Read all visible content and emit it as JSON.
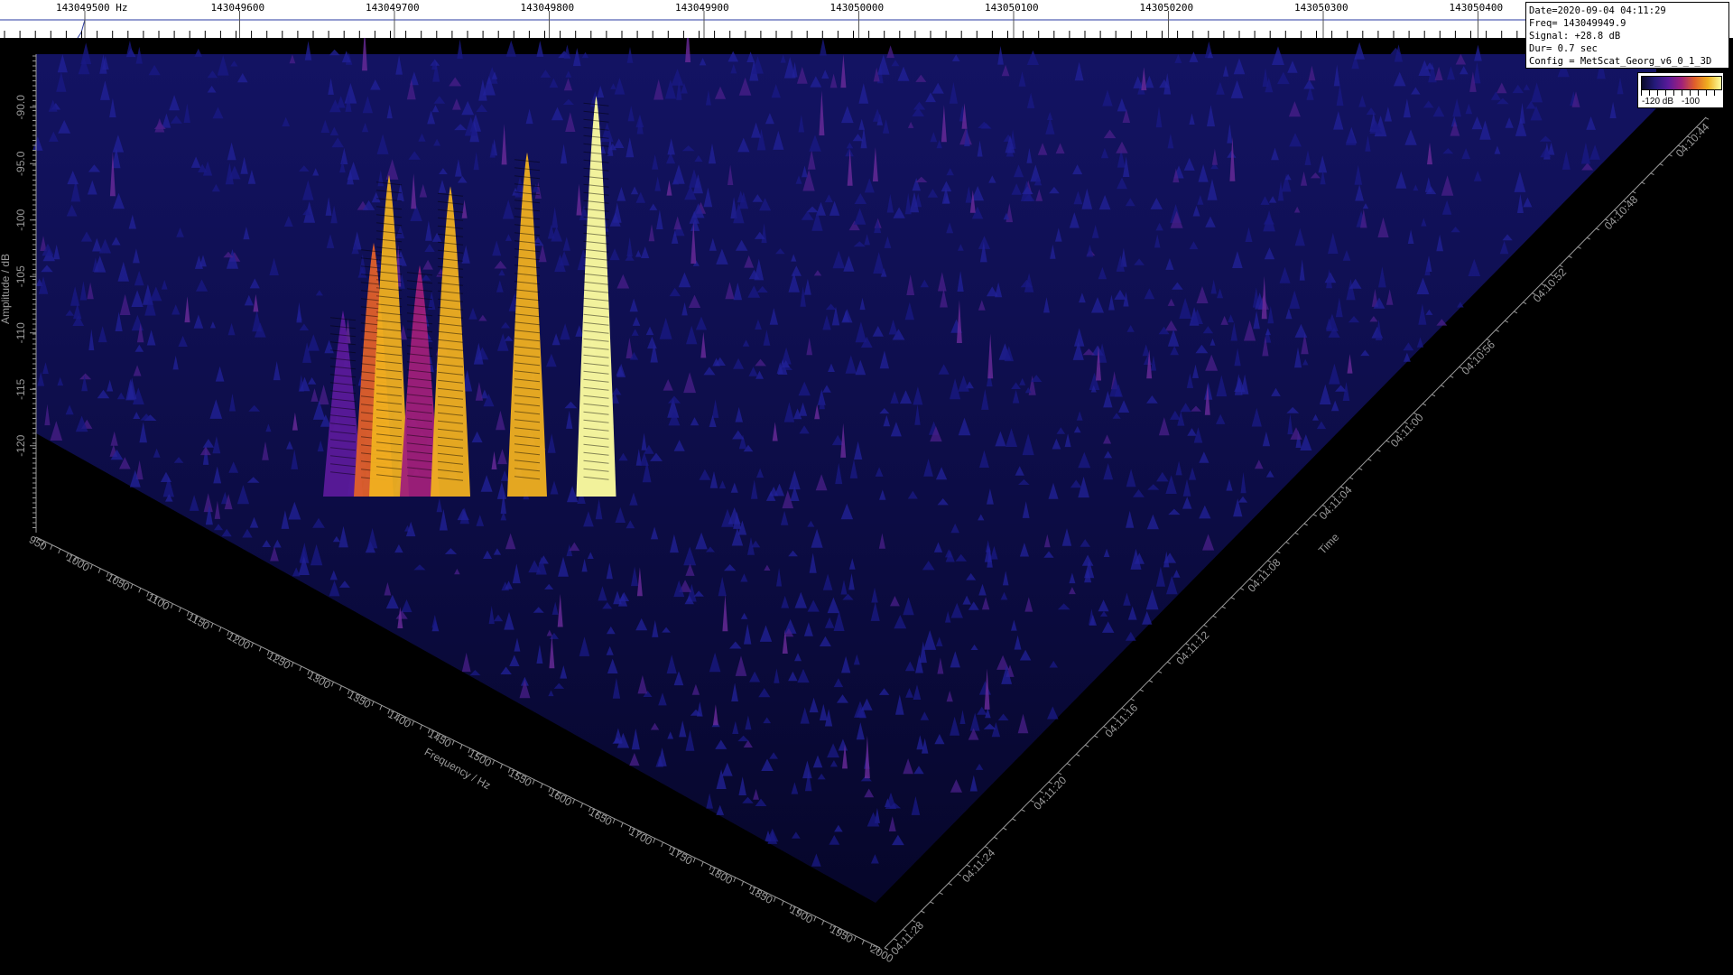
{
  "top_axis": {
    "unit": "Hz",
    "labels": [
      "143049500",
      "143049600",
      "143049700",
      "143049800",
      "143049900",
      "143050000",
      "143050100",
      "143050200",
      "143050300",
      "143050400"
    ]
  },
  "info": {
    "date": "Date=2020-09-04 04:11:29",
    "freq": "Freq= 143049949.9",
    "signal": "Signal: +28.8 dB",
    "duration": "Dur= 0.7 sec",
    "config": "Config = MetScat_Georg_v6_0_1_3D"
  },
  "colorbar": {
    "min_label": "-120 dB",
    "max_label": "-100",
    "colors": [
      "#0a0a2a",
      "#241a7a",
      "#5b1a9a",
      "#a0207a",
      "#e0602a",
      "#f0b020",
      "#ffffa0"
    ]
  },
  "chart_data": {
    "type": "3d waterfall (surface)",
    "amplitude_axis": {
      "label": "Amplitude / dB",
      "ticks": [
        "-90.0",
        "-95.0",
        "-100",
        "-105",
        "-110",
        "-115",
        "-120"
      ]
    },
    "frequency_axis": {
      "label": "Frequency / Hz",
      "ticks": [
        "950",
        "1000",
        "1050",
        "1100",
        "1150",
        "1200",
        "1250",
        "1300",
        "1350",
        "1400",
        "1450",
        "1500",
        "1550",
        "1600",
        "1650",
        "1700",
        "1750",
        "1800",
        "1850",
        "1900",
        "1950",
        "2000"
      ]
    },
    "time_axis": {
      "label": "Time",
      "ticks": [
        "04:11:28",
        "04:11:24",
        "04:11:20",
        "04:11:16",
        "04:11:12",
        "04:11:08",
        "04:11:04",
        "04:11:00",
        "04:10:56",
        "04:10:52",
        "04:10:48",
        "04:10:44"
      ]
    },
    "noise_floor_db": -115,
    "peaks": [
      {
        "freq_hz": 1440,
        "amp_db": -108
      },
      {
        "freq_hz": 1480,
        "amp_db": -102
      },
      {
        "freq_hz": 1500,
        "amp_db": -96
      },
      {
        "freq_hz": 1540,
        "amp_db": -104
      },
      {
        "freq_hz": 1580,
        "amp_db": -97
      },
      {
        "freq_hz": 1680,
        "amp_db": -94
      },
      {
        "freq_hz": 1770,
        "amp_db": -89
      }
    ]
  }
}
